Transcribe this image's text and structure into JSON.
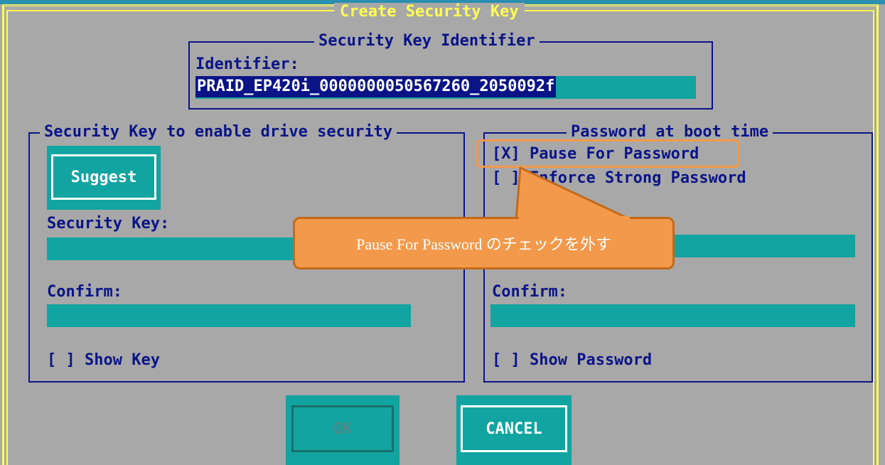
{
  "dialog": {
    "title": "Create Security Key"
  },
  "identifier_group": {
    "legend": "Security Key Identifier",
    "label": "Identifier:",
    "value": "PRAID_EP420i_0000000050567260_2050092f"
  },
  "security_key_group": {
    "legend": "Security Key to enable drive security",
    "suggest_label": "Suggest",
    "key_label": "Security Key:",
    "confirm_label": "Confirm:",
    "show_key_label": "[ ] Show Key"
  },
  "password_group": {
    "legend": "Password at boot time",
    "pause_checkbox": "[X] Pause For Password",
    "strong_checkbox": "[ ] Enforce Strong Password",
    "confirm_label": "Confirm:",
    "show_password_label": "[ ] Show Password"
  },
  "buttons": {
    "ok": "OK",
    "cancel": "CANCEL"
  },
  "callout": {
    "text": "Pause For Password のチェックを外す"
  },
  "colors": {
    "background": "#a8a8a8",
    "frame": "#ffff54",
    "text": "#0a1487",
    "field": "#12a4a0",
    "callout": "#f3994b"
  }
}
